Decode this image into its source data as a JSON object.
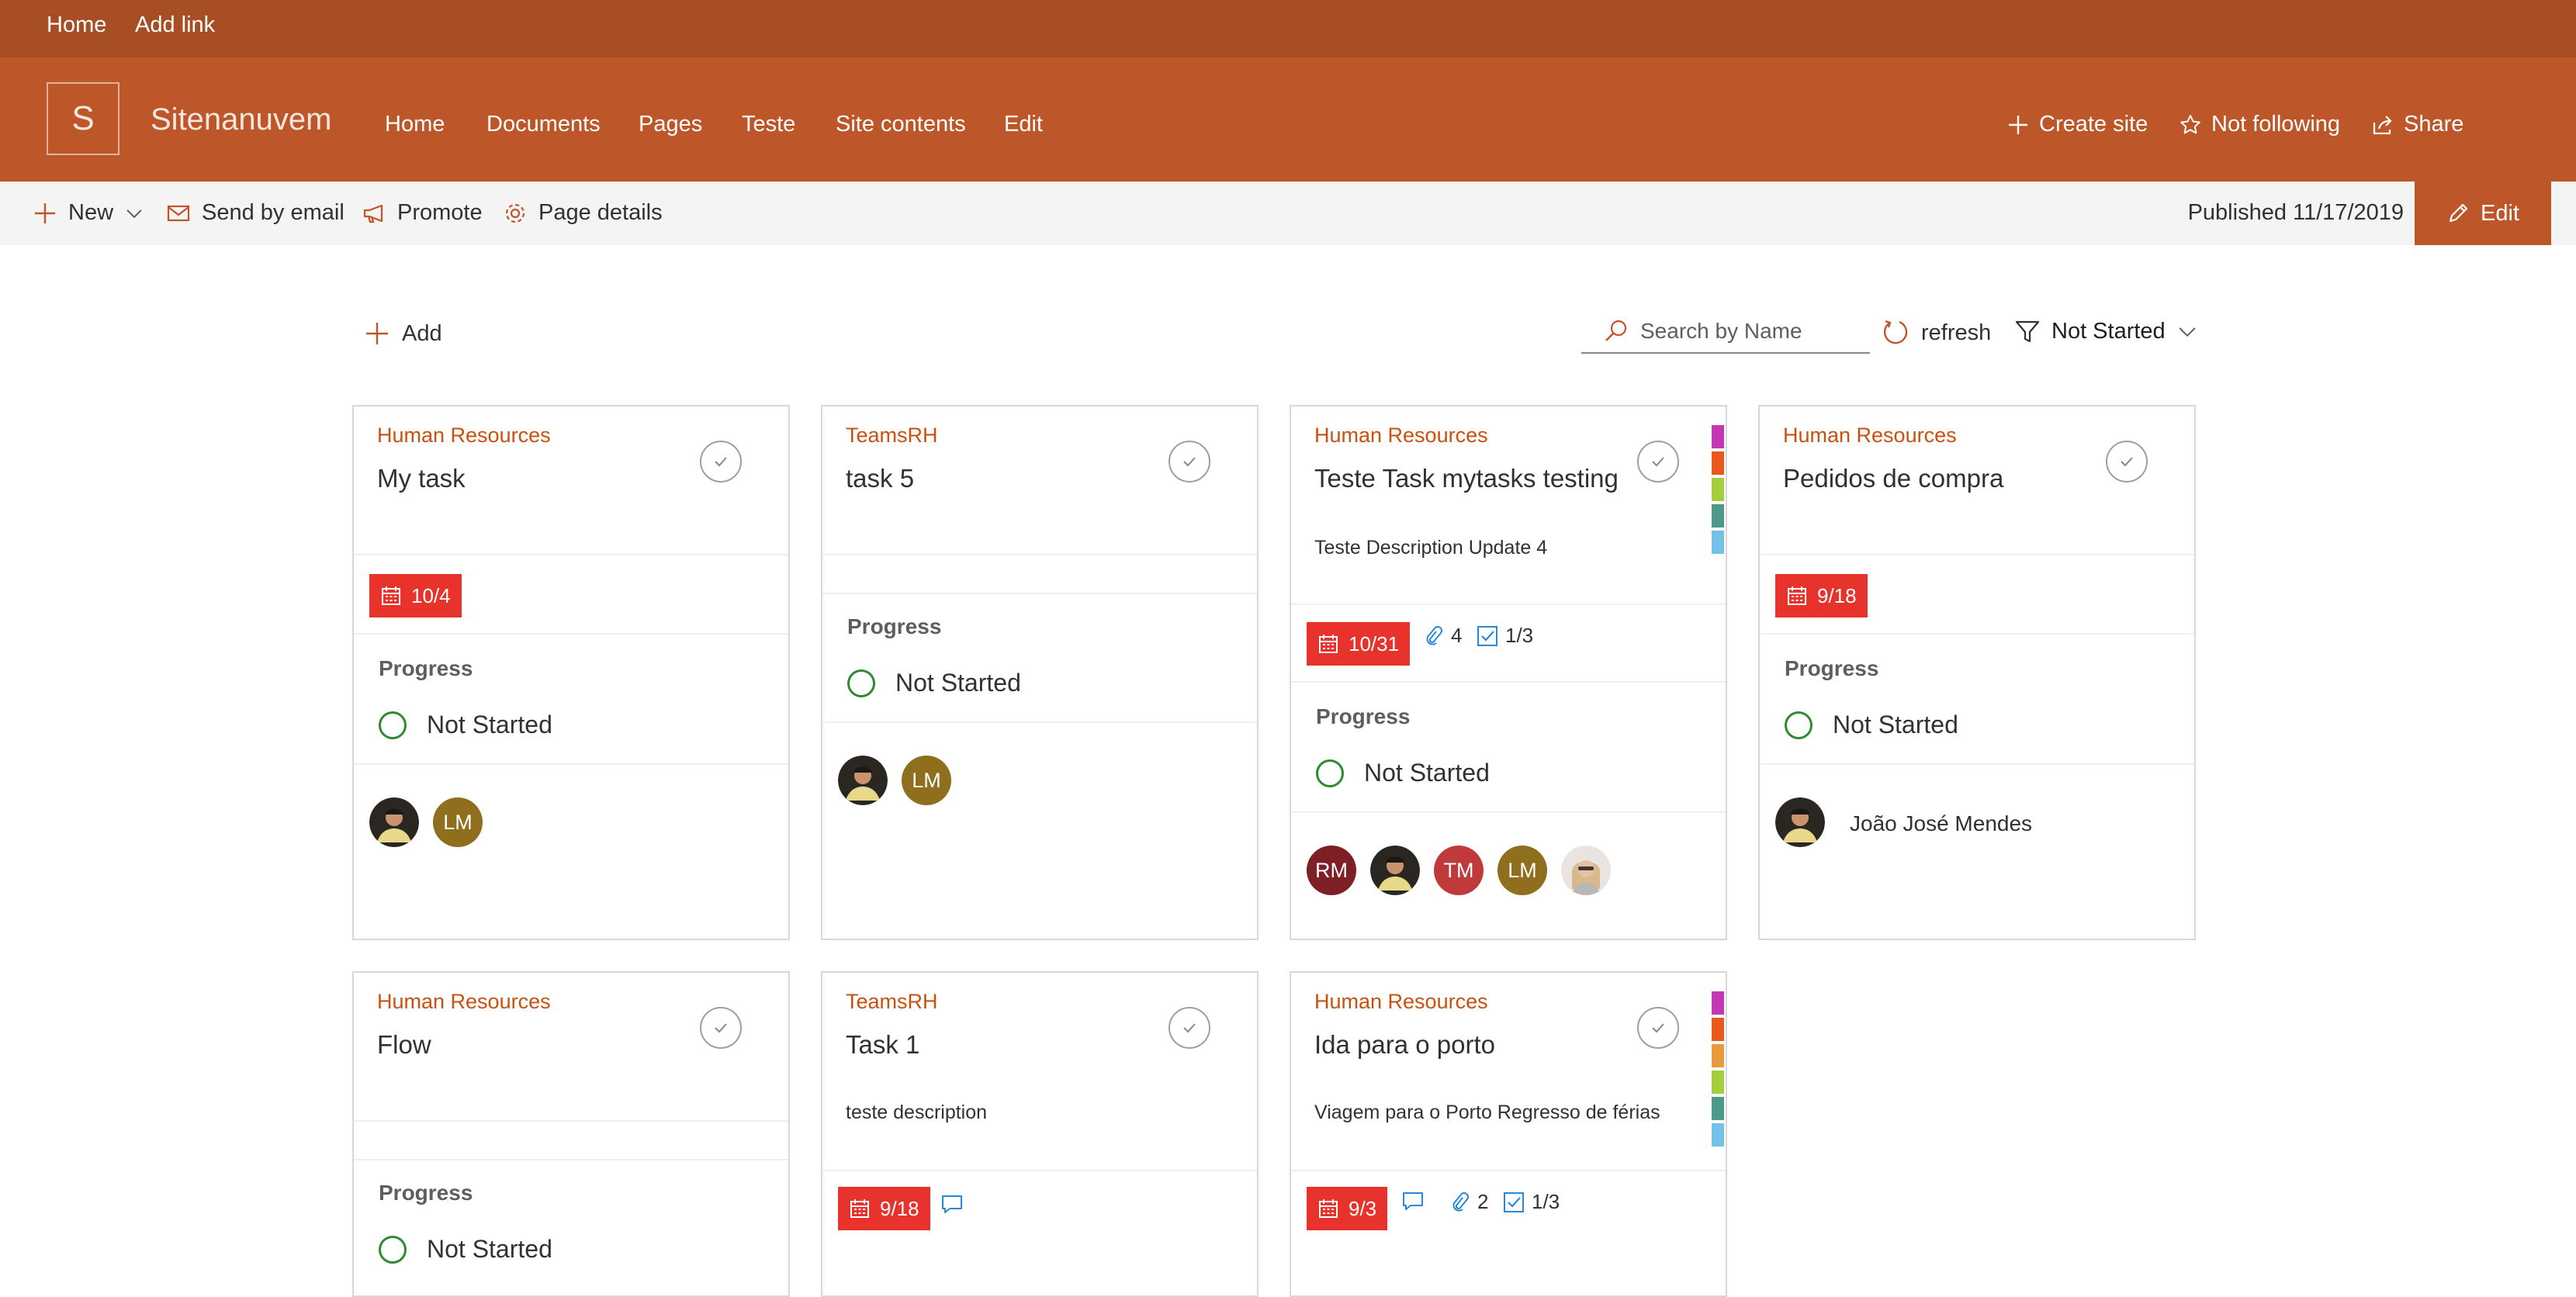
{
  "topbar": {
    "links": [
      "Home",
      "Add link"
    ]
  },
  "site": {
    "logo_letter": "S",
    "title": "Sitenanuvem",
    "nav": [
      "Home",
      "Documents",
      "Pages",
      "Teste",
      "Site contents",
      "Edit"
    ],
    "actions": {
      "create_site": "Create site",
      "follow": "Not following",
      "share": "Share"
    }
  },
  "commandbar": {
    "new": "New",
    "send_by_email": "Send by email",
    "promote": "Promote",
    "page_details": "Page details",
    "published": "Published 11/17/2019",
    "edit": "Edit"
  },
  "toolbar": {
    "add": "Add",
    "search_placeholder": "Search by Name",
    "refresh": "refresh",
    "filter": "Not Started"
  },
  "colors": {
    "brand": "#bd5628",
    "topbar": "#a84e24",
    "group_text": "#ca5010",
    "due_badge": "#e8322c",
    "progress_ring": "#2e8b2e",
    "category_colors": [
      "#c239b3",
      "#e8591a",
      "#a4cf3c",
      "#4e9a8a",
      "#73c1e6"
    ]
  },
  "progress_label": "Progress",
  "tasks": [
    {
      "group": "Human Resources",
      "title": "My task",
      "description": "",
      "due": "10/4",
      "attachments": "",
      "checklist": "",
      "has_comments": false,
      "progress": "Not Started",
      "assignees": [
        {
          "type": "photo"
        },
        {
          "initials": "LM",
          "color": "#8f6f1e"
        }
      ],
      "categories": false
    },
    {
      "group": "TeamsRH",
      "title": "task 5",
      "description": "",
      "due": "",
      "attachments": "",
      "checklist": "",
      "has_comments": false,
      "progress": "Not Started",
      "assignees": [
        {
          "type": "photo"
        },
        {
          "initials": "LM",
          "color": "#8f6f1e"
        }
      ],
      "categories": false
    },
    {
      "group": "Human Resources",
      "title": "Teste Task mytasks testing",
      "description": "Teste Description Update 4",
      "due": "10/31",
      "attachments": "4",
      "checklist": "1/3",
      "has_comments": false,
      "progress": "Not Started",
      "assignees": [
        {
          "initials": "RM",
          "color": "#7d1f24"
        },
        {
          "type": "photo"
        },
        {
          "initials": "TM",
          "color": "#c0393b"
        },
        {
          "initials": "LM",
          "color": "#8f6f1e"
        },
        {
          "type": "photo2"
        }
      ],
      "categories": true
    },
    {
      "group": "Human Resources",
      "title": "Pedidos de compra",
      "description": "",
      "due": "9/18",
      "attachments": "",
      "checklist": "",
      "has_comments": false,
      "progress": "Not Started",
      "assignees": [
        {
          "type": "photo"
        }
      ],
      "assignee_name": "João José Mendes",
      "categories": false
    },
    {
      "group": "Human Resources",
      "title": "Flow",
      "description": "",
      "due": "",
      "attachments": "",
      "checklist": "",
      "has_comments": false,
      "progress": "Not Started",
      "assignees": [],
      "categories": false
    },
    {
      "group": "TeamsRH",
      "title": "Task 1",
      "description": "teste description",
      "due": "9/18",
      "attachments": "",
      "checklist": "",
      "has_comments": true,
      "progress": "",
      "assignees": [],
      "categories": false
    },
    {
      "group": "Human Resources",
      "title": "Ida para o porto",
      "description": "Viagem para o Porto Regresso de férias",
      "due": "9/3",
      "attachments": "2",
      "checklist": "1/3",
      "has_comments": true,
      "progress": "",
      "assignees": [],
      "categories": true
    }
  ]
}
